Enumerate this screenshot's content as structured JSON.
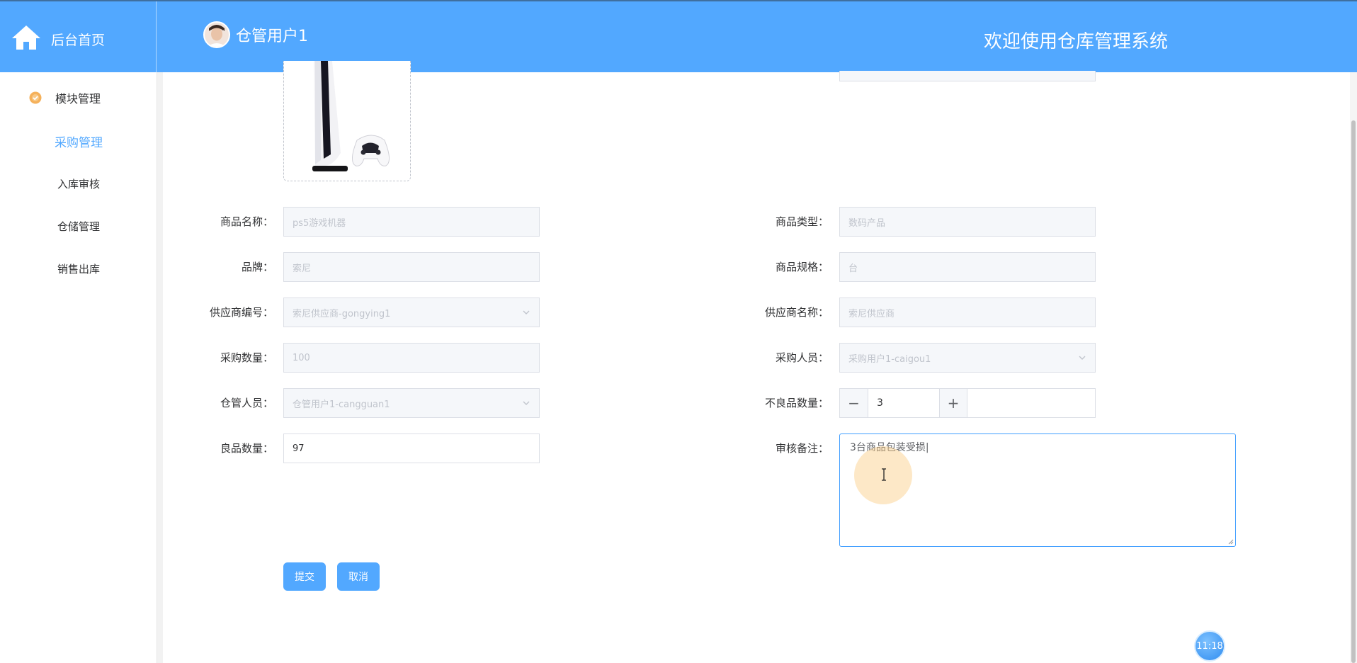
{
  "theme": {
    "accent": "#52a8ff",
    "text": "#303133",
    "placeholder": "#c0c4cc",
    "focus": "#409eff"
  },
  "header": {
    "home_label": "后台首页",
    "user_name": "仓管用户1",
    "welcome": "欢迎使用仓库管理系统",
    "icons": {
      "home": "home-icon",
      "avatar": "user-avatar"
    }
  },
  "sidebar": {
    "group_label": "模块管理",
    "group_icon": "gear-badge-icon",
    "items": [
      {
        "label": "采购管理",
        "active": true
      },
      {
        "label": "入库审核",
        "active": false
      },
      {
        "label": "仓储管理",
        "active": false
      },
      {
        "label": "销售出库",
        "active": false
      }
    ]
  },
  "form": {
    "product_name": {
      "label": "商品名称：",
      "value": "ps5游戏机器"
    },
    "product_type": {
      "label": "商品类型：",
      "value": "数码产品"
    },
    "brand": {
      "label": "品牌：",
      "value": "索尼"
    },
    "spec": {
      "label": "商品规格：",
      "value": "台"
    },
    "supplier_code": {
      "label": "供应商编号：",
      "value": "索尼供应商-gongying1"
    },
    "supplier_name": {
      "label": "供应商名称：",
      "value": "索尼供应商"
    },
    "purchase_qty": {
      "label": "采购数量：",
      "value": "100"
    },
    "purchaser": {
      "label": "采购人员：",
      "value": "采购用户1-caigou1"
    },
    "keeper": {
      "label": "仓管人员：",
      "value": "仓管用户1-cangguan1"
    },
    "defect_qty": {
      "label": "不良品数量：",
      "value": "3",
      "minus": "−",
      "plus": "+"
    },
    "good_qty": {
      "label": "良品数量：",
      "value": "97"
    },
    "review_note": {
      "label": "审核备注：",
      "value": "3台商品包装受损|"
    }
  },
  "buttons": {
    "submit": "提交",
    "cancel": "取消"
  },
  "clock": "11:18"
}
